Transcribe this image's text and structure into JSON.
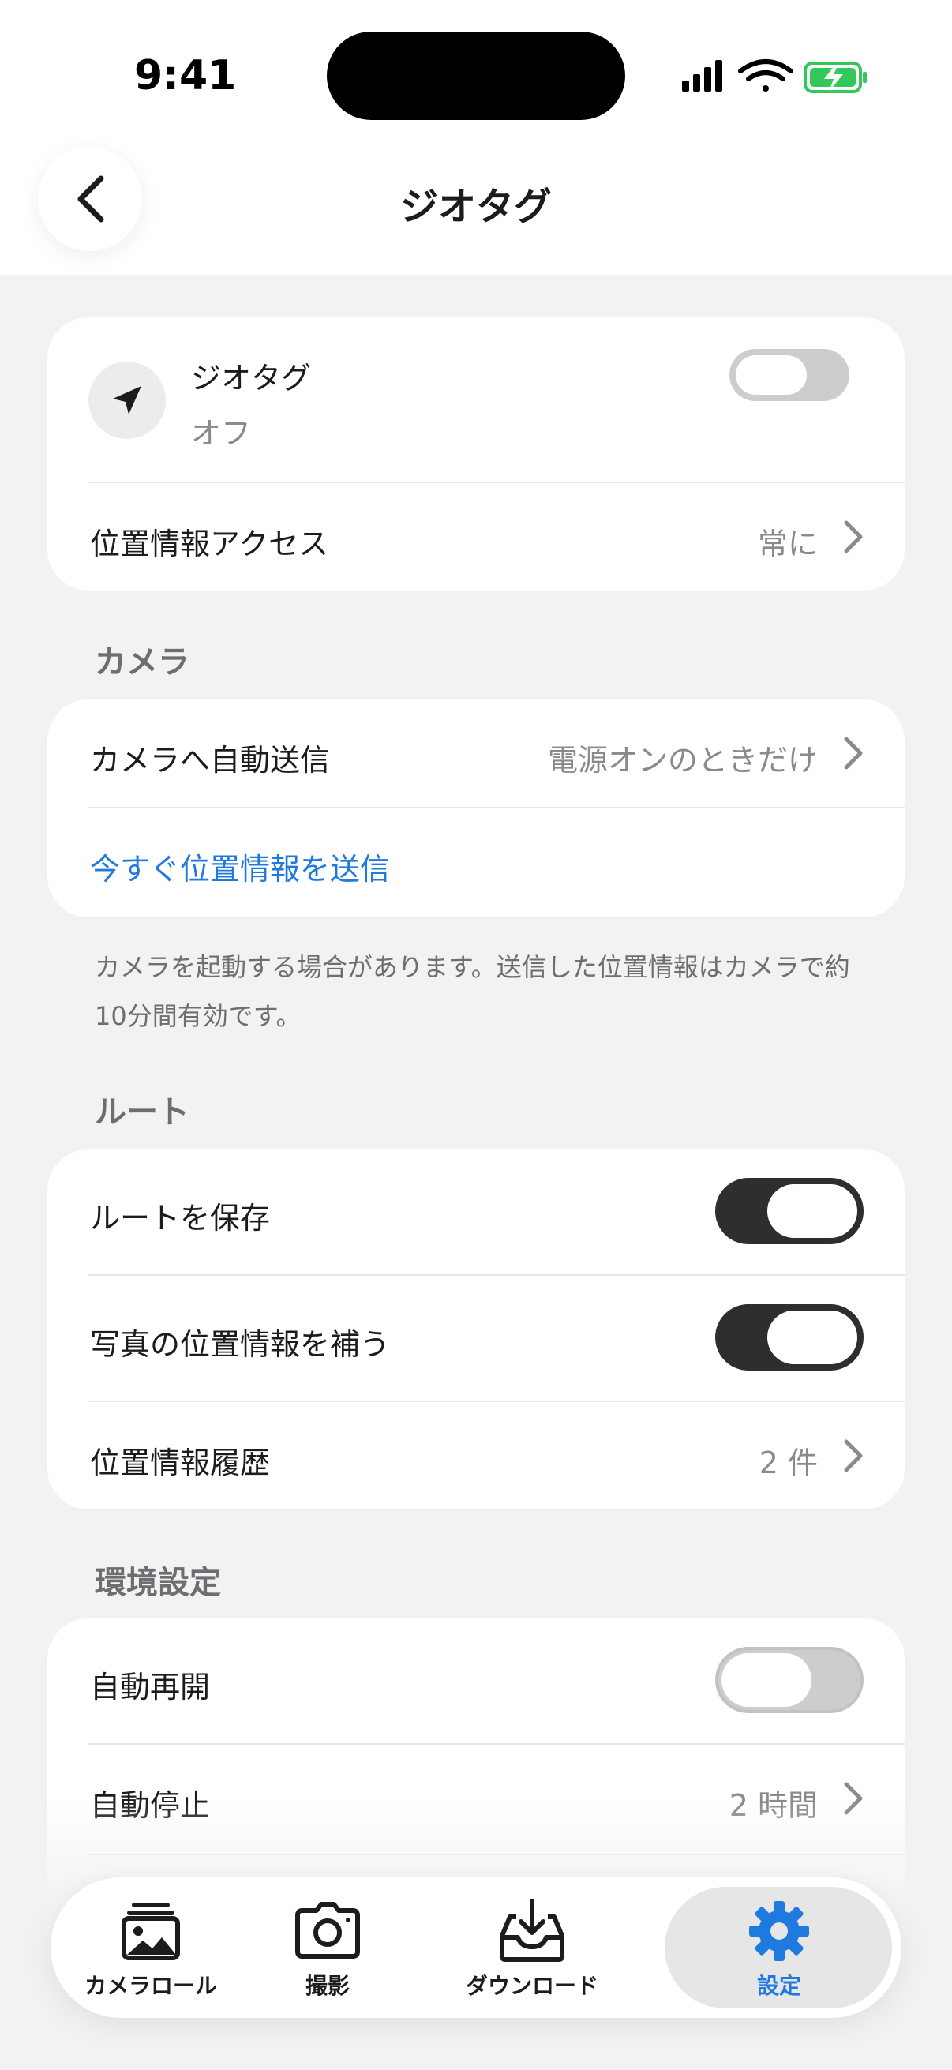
{
  "status_bar": {
    "time": "9:41"
  },
  "nav": {
    "title": "ジオタグ"
  },
  "geotag_card": {
    "title": "ジオタグ",
    "state": "オフ",
    "toggle_on": false,
    "location_access_label": "位置情報アクセス",
    "location_access_value": "常に"
  },
  "camera_section": {
    "header": "カメラ",
    "auto_send_label": "カメラへ自動送信",
    "auto_send_value": "電源オンのときだけ",
    "send_now_label": "今すぐ位置情報を送信",
    "note": "カメラを起動する場合があります。送信した位置情報はカメラで約10分間有効です。"
  },
  "route_section": {
    "header": "ルート",
    "save_route_label": "ルートを保存",
    "save_route_on": true,
    "supplement_label": "写真の位置情報を補う",
    "supplement_on": true,
    "history_label": "位置情報履歴",
    "history_value": "2 件"
  },
  "prefs_section": {
    "header": "環境設定",
    "auto_resume_label": "自動再開",
    "auto_resume_on": false,
    "auto_stop_label": "自動停止",
    "auto_stop_value": "2 時間"
  },
  "tabbar": {
    "tabs": [
      {
        "label": "カメラロール",
        "icon": "photo-stack-icon"
      },
      {
        "label": "撮影",
        "icon": "camera-icon"
      },
      {
        "label": "ダウンロード",
        "icon": "download-tray-icon"
      },
      {
        "label": "設定",
        "icon": "gear-icon",
        "active": true
      }
    ]
  },
  "colors": {
    "accent": "#1f7ae0",
    "toggle_on": "#2e2e30",
    "toggle_off": "#cdcdcf",
    "background": "#f2f2f2"
  }
}
